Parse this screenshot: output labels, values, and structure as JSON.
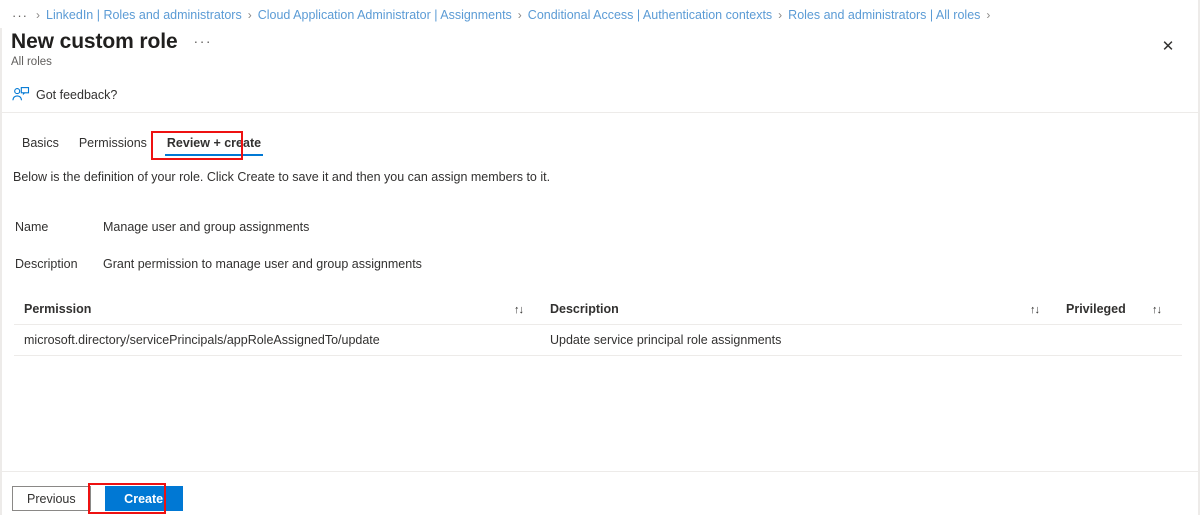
{
  "breadcrumb": {
    "overflow": "···",
    "separator": "›",
    "items": [
      "LinkedIn | Roles and administrators",
      "Cloud Application Administrator | Assignments",
      "Conditional Access | Authentication contexts",
      "Roles and administrators | All roles"
    ]
  },
  "header": {
    "title": "New custom role",
    "title_ellipsis": "···",
    "subtitle": "All roles",
    "close_icon": "✕"
  },
  "commandbar": {
    "feedback_label": "Got feedback?",
    "feedback_icon": "feedback-person-icon"
  },
  "tabs": [
    {
      "label": "Basics",
      "selected": false
    },
    {
      "label": "Permissions",
      "selected": false
    },
    {
      "label": "Review + create",
      "selected": true
    }
  ],
  "intro": "Below is the definition of your role. Click Create to save it and then you can assign members to it.",
  "fields": [
    {
      "label": "Name",
      "value": "Manage user and group assignments"
    },
    {
      "label": "Description",
      "value": "Grant permission to manage user and group assignments"
    }
  ],
  "table": {
    "sort_icon": "↑↓",
    "columns": [
      "Permission",
      "Description",
      "Privileged"
    ],
    "rows": [
      {
        "permission": "microsoft.directory/servicePrincipals/appRoleAssignedTo/update",
        "description": "Update service principal role assignments",
        "privileged": ""
      }
    ]
  },
  "footer": {
    "previous_label": "Previous",
    "create_label": "Create"
  },
  "colors": {
    "accent": "#0078d4",
    "highlight": "#ee1111",
    "link": "#5b9bd5",
    "border": "#edebe9"
  }
}
